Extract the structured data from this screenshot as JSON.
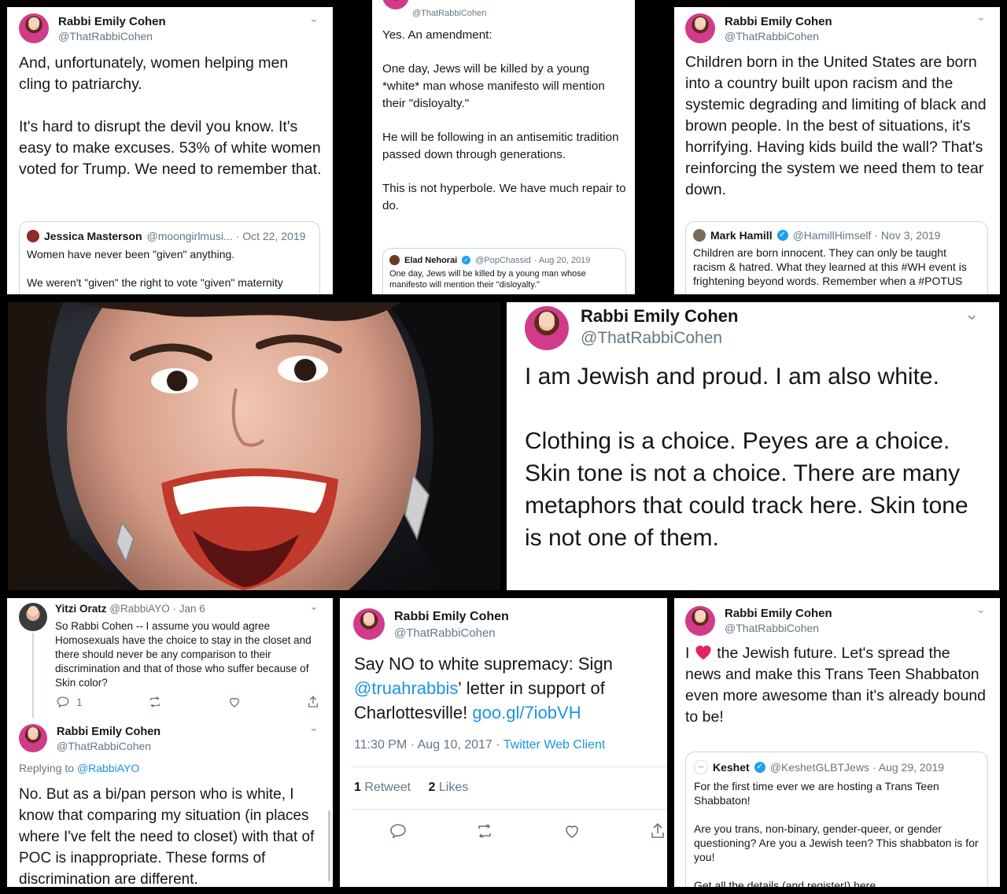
{
  "tweet1": {
    "name": "Rabbi Emily Cohen",
    "handle": "@ThatRabbiCohen",
    "text": "And, unfortunately, women helping men cling to patriarchy.\n\nIt's hard to disrupt the devil you know. It's easy to make excuses. 53% of white women voted for Trump. We need to remember that.",
    "quote": {
      "name": "Jessica Masterson",
      "handle": "@moongirlmusi...",
      "date": "· Oct 22, 2019",
      "text": "Women have never been \"given\" anything.\n\nWe weren't \"given\" the right to vote  \"given\" maternity"
    }
  },
  "tweet2": {
    "handle": "@ThatRabbiCohen",
    "text": "Yes. An amendment:\n\nOne day, Jews will be killed by a young *white* man whose manifesto will mention their \"disloyalty.\"\n\nHe will be following in an antisemitic tradition passed down through generations.\n\nThis is not hyperbole. We have much repair to do.",
    "quote": {
      "name": "Elad Nehorai",
      "handle": "@PopChassid",
      "date": "· Aug 20, 2019",
      "text": "One day, Jews will be killed by a young man whose manifesto will mention their \"disloyalty.\""
    }
  },
  "tweet3": {
    "name": "Rabbi Emily Cohen",
    "handle": "@ThatRabbiCohen",
    "text": "Children born in the United States are born into a country built upon racism and the systemic degrading and limiting of black and brown people. In the best of situations, it's horrifying. Having kids build the wall? That's reinforcing the system we need them to tear down.",
    "quote": {
      "name": "Mark Hamill",
      "handle": "@HamillHimself",
      "date": "· Nov 3, 2019",
      "text": "Children are born innocent. They can only be taught racism & hatred. What they learned at this #WH event is frightening beyond words. Remember when a #POTUS"
    }
  },
  "tweet4": {
    "name": "Rabbi Emily Cohen",
    "handle": "@ThatRabbiCohen",
    "text": "I am Jewish and proud. I am also white.\n\nClothing is a choice. Peyes are a choice. Skin tone is not a choice. There are many metaphors that could track here. Skin tone is not one of them."
  },
  "tweet5": {
    "reply_name": "Yitzi Oratz",
    "reply_handle": "@RabbiAYO",
    "reply_date": "· Jan 6",
    "reply_text": "So Rabbi Cohen -- I assume you would agree Homosexuals have the choice to stay in the closet and there should never be any comparison to their discrimination and that of those who suffer because of Skin color?",
    "reply_count": "1",
    "name": "Rabbi Emily Cohen",
    "handle": "@ThatRabbiCohen",
    "replying_prefix": "Replying to ",
    "replying_to": "@RabbiAYO",
    "text": "No. But as a bi/pan person who is white, I know that comparing my situation (in places where I've felt the need to closet) with that of POC is inappropriate. These forms of discrimination are different."
  },
  "tweet6": {
    "name": "Rabbi Emily Cohen",
    "handle": "@ThatRabbiCohen",
    "text_a": "Say NO to white supremacy: Sign ",
    "mention": "@truahrabbis",
    "text_b": "' letter in support of Charlottesville! ",
    "url": "goo.gl/7iobVH",
    "timestamp": "11:30 PM · Aug 10, 2017 · ",
    "client": "Twitter Web Client",
    "retweet_count": "1",
    "retweet_label": "Retweet",
    "likes_count": "2",
    "likes_label": "Likes"
  },
  "tweet7": {
    "name": "Rabbi Emily Cohen",
    "handle": "@ThatRabbiCohen",
    "text_a": "I ",
    "text_b": " the Jewish future. Let's spread the news and make this Trans Teen Shabbaton even more awesome than it's already bound to be!",
    "quote": {
      "name": "Keshet",
      "handle": "@KeshetGLBTJews",
      "date": "· Aug 29, 2019",
      "text": "For the first time ever we are hosting a Trans Teen Shabbaton!\n\nAre you trans, non-binary, gender-queer, or gender questioning? Are you a Jewish teen? This shabbaton is for you!\n\nGet all the details (and register!) here"
    }
  },
  "colors": {
    "link": "#1b95e0",
    "verified": "#1da1f2",
    "heart": "#e0245e"
  },
  "icons": [
    "chevron-down-icon",
    "reply-icon",
    "retweet-icon",
    "like-icon",
    "share-icon",
    "verified-icon",
    "heart-icon"
  ]
}
